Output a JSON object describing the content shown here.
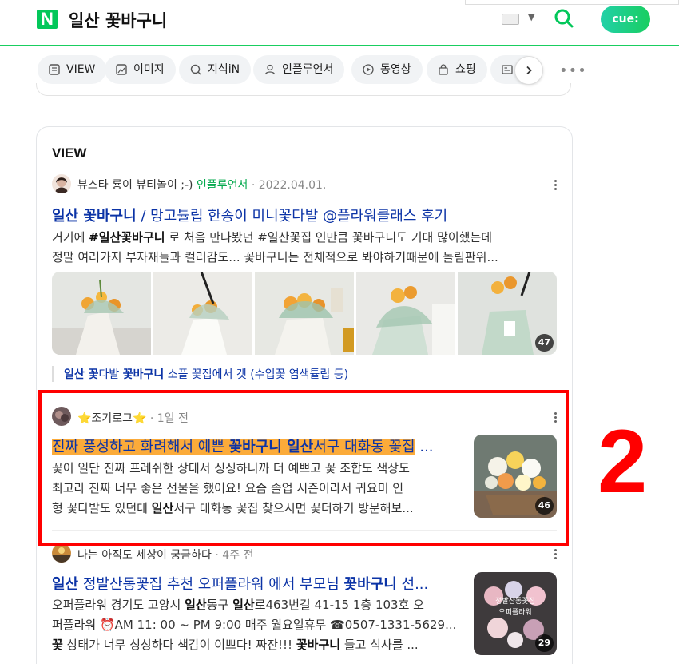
{
  "header": {
    "logo": "N",
    "query": "일산 꽃바구니",
    "cue_label": "cue:"
  },
  "tabs": [
    {
      "label": "VIEW",
      "icon": "view-icon"
    },
    {
      "label": "이미지",
      "icon": "image-icon"
    },
    {
      "label": "지식iN",
      "icon": "knowledge-icon"
    },
    {
      "label": "인플루언서",
      "icon": "person-icon"
    },
    {
      "label": "동영상",
      "icon": "play-icon"
    },
    {
      "label": "쇼핑",
      "icon": "bag-icon"
    },
    {
      "label": "",
      "icon": "news-icon"
    }
  ],
  "view": {
    "title": "VIEW",
    "post1": {
      "author": "뷰스타 룡이 뷰티놀이 ;-)",
      "badge": "인플루언서",
      "sep": "·",
      "date": "2022.04.01.",
      "title_bold": "일산 꽃바구니",
      "title_rest": " / 망고튤립 한송이 미니꽃다발 @플라워클래스 후기",
      "desc_line1_a": "거기에 ",
      "desc_line1_b": "#일산꽃바구니",
      "desc_line1_c": " 로 처음 만나봤던 #일산꽃집 인만큼 꽃바구니도 기대 많이했는데",
      "desc_line2": "정말 여러가지 부자재들과 컬러감도... 꽃바구니는 전체적으로 봐야하기때문에 돌림판위...",
      "image_count": "47",
      "sub_bold1": "일산 꽃",
      "sub_mid": "다발 ",
      "sub_bold2": "꽃바구니",
      "sub_rest": " 소플 꽃집에서 겟 (수입꽃 염색튤립 등)"
    },
    "post2": {
      "author": "⭐조기로그⭐",
      "sep": "·",
      "date": "1일 전",
      "title_a": "진짜 풍성하고 화려해서 예쁜 ",
      "title_b": "꽃바구니 일산",
      "title_c": "서구 대화동 꽃집",
      "title_ellipsis": " ...",
      "desc_line1": "꽃이 일단 진짜 프레쉬한 상태서 싱싱하니까 더 예쁘고 꽃 조합도 색상도",
      "desc_line2": "최고라 진짜 너무 좋은 선물을 했어요! 요즘 졸업 시즌이라서 귀요미 인",
      "desc_line3_a": "형 꽃다발도 있던데 ",
      "desc_line3_b": "일산",
      "desc_line3_c": "서구 대화동 꽃집 찾으시면 꽃더하기 방문해보...",
      "image_count": "46"
    },
    "post3": {
      "author": "나는 아직도 세상이 궁금하다",
      "sep": "·",
      "date": "4주 전",
      "title_a": "일산",
      "title_b": " 정발산동꽃집 추천 오퍼플라워 에서 부모님 ",
      "title_c": "꽃바구니",
      "title_d": " 선...",
      "desc_line1_a": "오퍼플라워 경기도 고양시 ",
      "desc_line1_b": "일산",
      "desc_line1_c": "동구 ",
      "desc_line1_d": "일산",
      "desc_line1_e": "로463번길 41-15 1층 103호 오",
      "desc_line2": "퍼플라워 ⏰AM 11: 00 ~ PM 9:00 매주 월요일휴무 ☎0507-1331-5629...",
      "desc_line3_a": "꽃",
      "desc_line3_b": " 상태가 너무 싱싱하다 색감이 이쁘다! 짜잔!!! ",
      "desc_line3_c": "꽃바구니",
      "desc_line3_d": " 들고 식사를 ...",
      "thumb_text1": "정발산동꽃집",
      "thumb_text2": "오퍼플라워",
      "image_count": "29"
    }
  },
  "annotation": {
    "label": "2"
  },
  "colors": {
    "naver_green": "#03c75a",
    "link_blue": "#0b33a6",
    "highlight": "#fbab3a",
    "annotation_red": "#ff0000"
  }
}
